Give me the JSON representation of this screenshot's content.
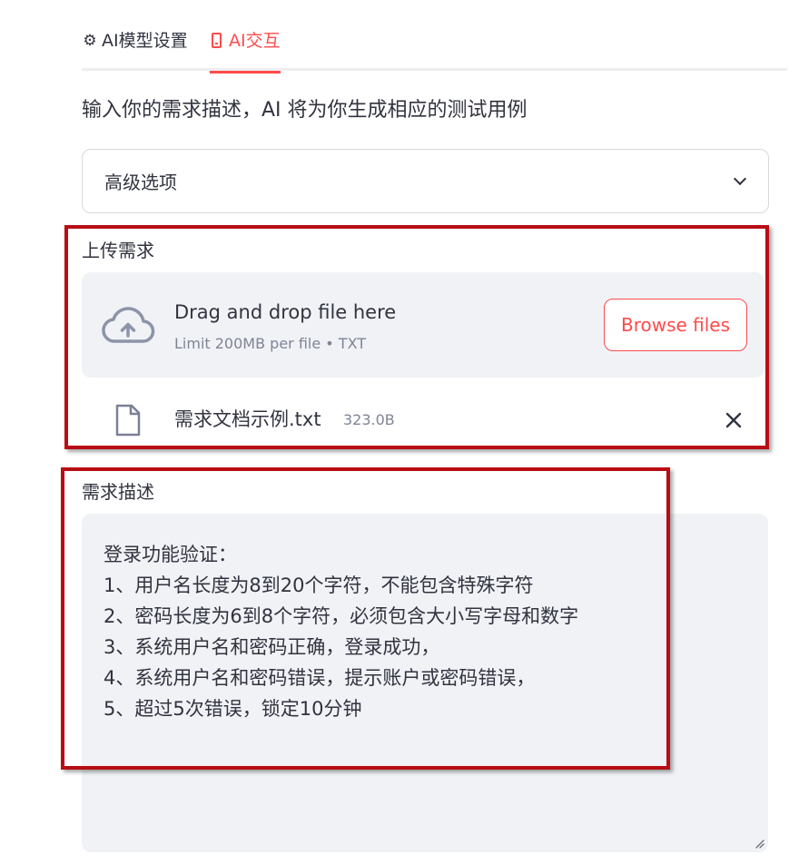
{
  "tabs": [
    {
      "icon": "gear-icon",
      "glyph": "⚙",
      "label": "AI模型设置",
      "active": false
    },
    {
      "icon": "phone-icon",
      "label": "AI交互",
      "active": true
    }
  ],
  "intro": "输入你的需求描述，AI 将为你生成相应的测试用例",
  "advanced": {
    "label": "高级选项"
  },
  "upload": {
    "label": "上传需求",
    "drop_title": "Drag and drop file here",
    "drop_sub": "Limit 200MB per file • TXT",
    "browse_label": "Browse files",
    "file": {
      "name": "需求文档示例.txt",
      "size": "323.0B"
    }
  },
  "description": {
    "label": "需求描述",
    "lines": [
      "登录功能验证：",
      "1、用户名长度为8到20个字符，不能包含特殊字符",
      "2、密码长度为6到8个字符，必须包含大小写字母和数字",
      "3、系统用户名和密码正确，登录成功，",
      "4、系统用户名和密码错误，提示账户或密码错误，",
      "5、超过5次错误，锁定10分钟"
    ]
  },
  "colors": {
    "accent": "#ff4b4b",
    "highlight": "#b80d14",
    "panel_bg": "#f0f2f6",
    "text": "#31333f",
    "muted": "#808495"
  }
}
